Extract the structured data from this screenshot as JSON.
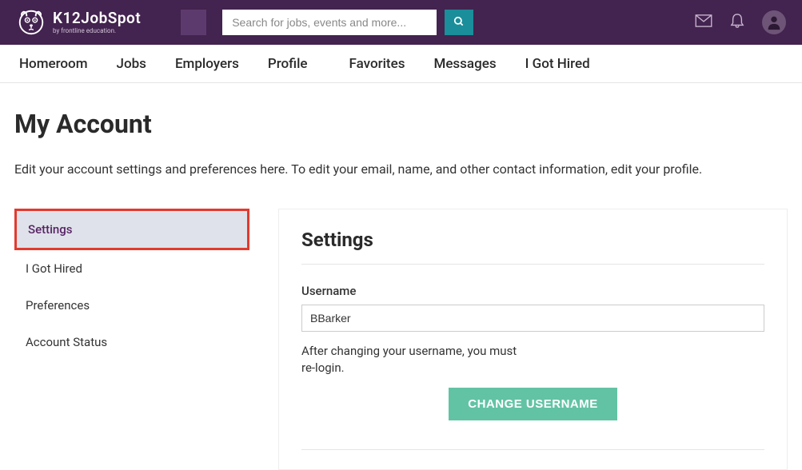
{
  "header": {
    "logo_title": "K12JobSpot",
    "logo_subtitle": "by frontline education.",
    "search_placeholder": "Search for jobs, events and more..."
  },
  "nav": {
    "items": [
      "Homeroom",
      "Jobs",
      "Employers",
      "Profile",
      "Favorites",
      "Messages",
      "I Got Hired"
    ]
  },
  "page": {
    "title": "My Account",
    "description": "Edit your account settings and preferences here. To edit your email, name, and other contact information, edit your profile."
  },
  "sidebar": {
    "items": [
      "Settings",
      "I Got Hired",
      "Preferences",
      "Account Status"
    ],
    "active_index": 0
  },
  "panel": {
    "title": "Settings",
    "username_label": "Username",
    "username_value": "BBarker",
    "username_hint": "After changing your username, you must re-login.",
    "change_username_button": "CHANGE USERNAME"
  }
}
